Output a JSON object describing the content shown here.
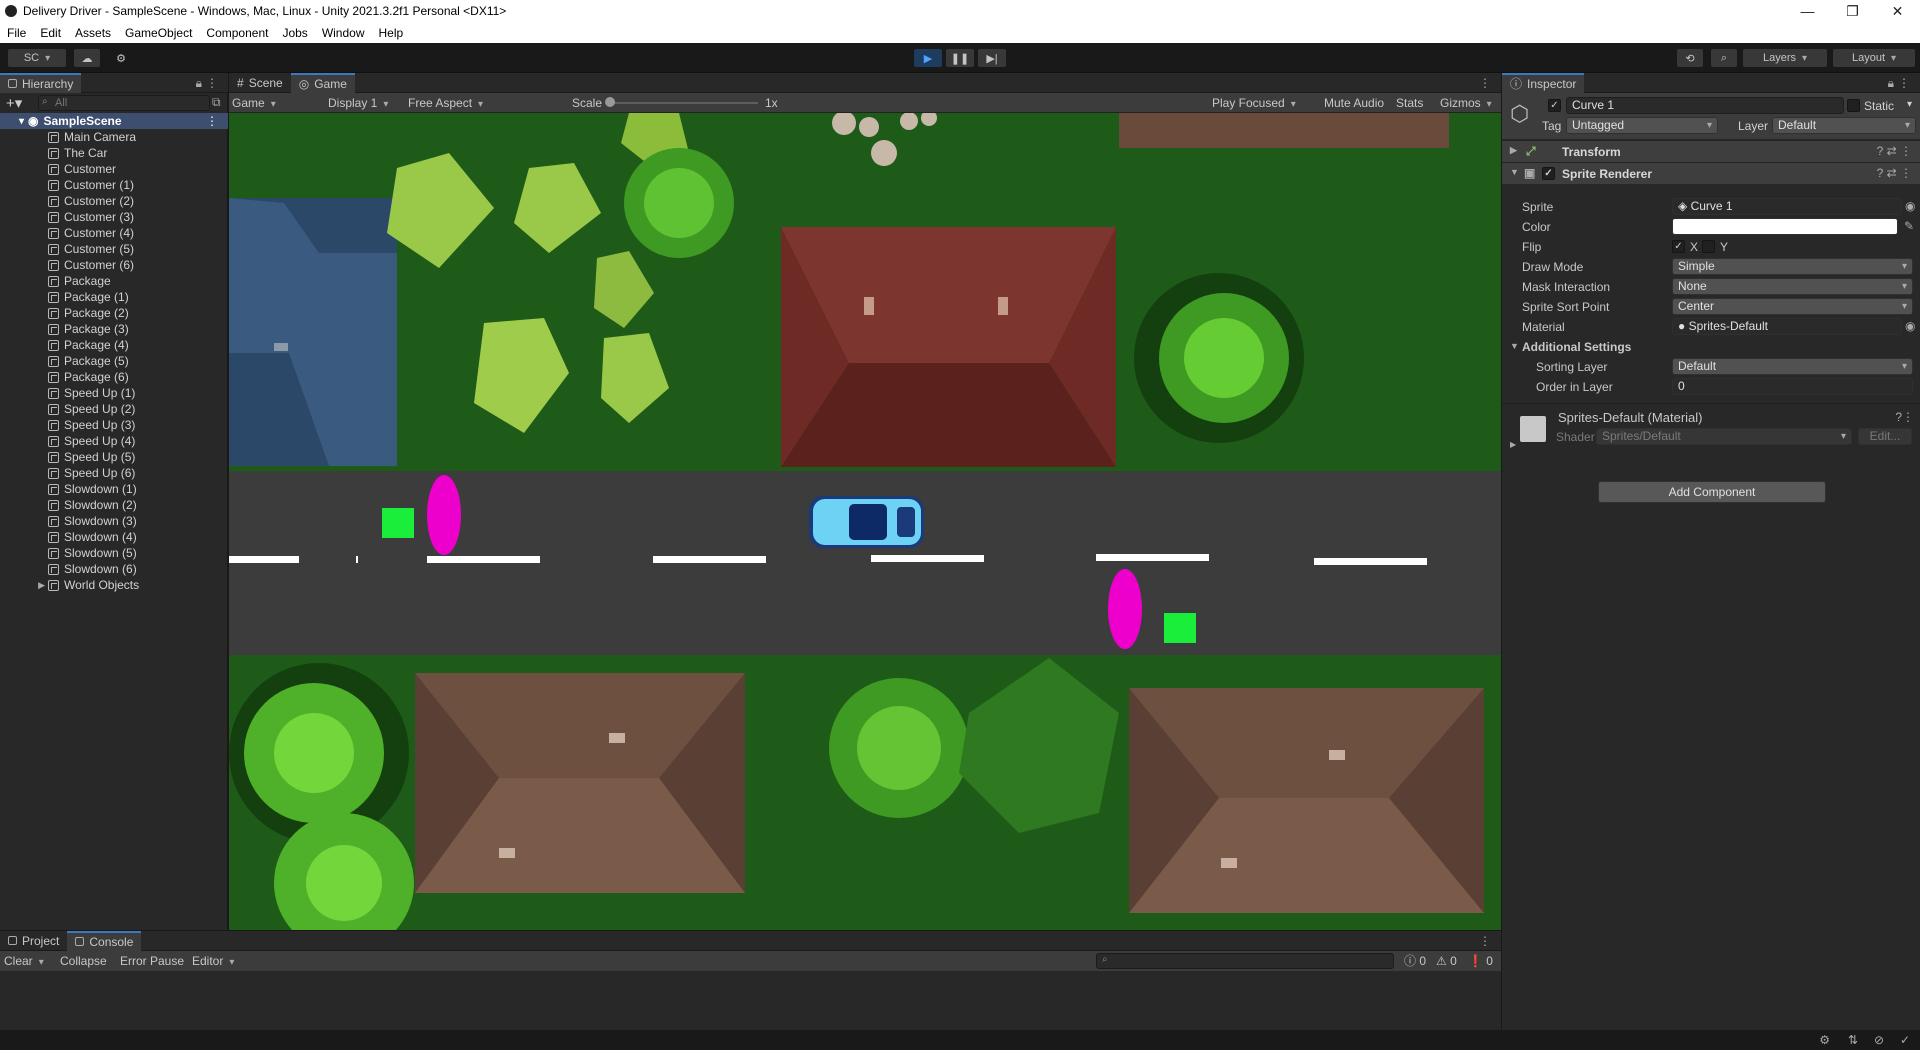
{
  "window": {
    "title": "Delivery Driver - SampleScene - Windows, Mac, Linux - Unity 2021.3.2f1 Personal <DX11>",
    "minimize": "—",
    "maximize": "❐",
    "close": "✕"
  },
  "menu": [
    "File",
    "Edit",
    "Assets",
    "GameObject",
    "Component",
    "Jobs",
    "Window",
    "Help"
  ],
  "toolbar": {
    "account": "SC",
    "layers": "Layers",
    "layout": "Layout"
  },
  "hierarchy": {
    "tab": "Hierarchy",
    "search_placeholder": "All",
    "scene": "SampleScene",
    "items": [
      "Main Camera",
      "The Car",
      "Customer",
      "Customer (1)",
      "Customer (2)",
      "Customer (3)",
      "Customer (4)",
      "Customer (5)",
      "Customer (6)",
      "Package",
      "Package (1)",
      "Package (2)",
      "Package (3)",
      "Package (4)",
      "Package (5)",
      "Package (6)",
      "Speed Up (1)",
      "Speed Up (2)",
      "Speed Up (3)",
      "Speed Up (4)",
      "Speed Up (5)",
      "Speed Up (6)",
      "Slowdown (1)",
      "Slowdown (2)",
      "Slowdown (3)",
      "Slowdown (4)",
      "Slowdown (5)",
      "Slowdown (6)",
      "World Objects"
    ]
  },
  "view": {
    "tabs": [
      "Scene",
      "Game"
    ],
    "game_mode": "Game",
    "display": "Display 1",
    "aspect": "Free Aspect",
    "scale_label": "Scale",
    "scale_value": "1x",
    "scale_level": 0,
    "play_focused": "Play Focused",
    "mute_audio": "Mute Audio",
    "stats": "Stats",
    "gizmos": "Gizmos"
  },
  "bottom": {
    "tabs": [
      "Project",
      "Console"
    ],
    "clear": "Clear",
    "collapse": "Collapse",
    "error_pause": "Error Pause",
    "editor": "Editor",
    "info_count": "0",
    "warn_count": "0",
    "error_count": "0"
  },
  "inspector": {
    "tab": "Inspector",
    "object_name": "Curve 1",
    "static": "Static",
    "tag_label": "Tag",
    "tag_value": "Untagged",
    "layer_label": "Layer",
    "layer_value": "Default",
    "transform": "Transform",
    "sprite_renderer": "Sprite Renderer",
    "fields": {
      "sprite": {
        "label": "Sprite",
        "value": "Curve 1"
      },
      "color": {
        "label": "Color"
      },
      "flip": {
        "label": "Flip",
        "x": "X",
        "y": "Y"
      },
      "draw_mode": {
        "label": "Draw Mode",
        "value": "Simple"
      },
      "mask_interaction": {
        "label": "Mask Interaction",
        "value": "None"
      },
      "sprite_sort_point": {
        "label": "Sprite Sort Point",
        "value": "Center"
      },
      "material": {
        "label": "Material",
        "value": "Sprites-Default"
      }
    },
    "additional_settings": "Additional Settings",
    "sorting_layer": {
      "label": "Sorting Layer",
      "value": "Default"
    },
    "order_in_layer": {
      "label": "Order in Layer",
      "value": "0"
    },
    "material_name": "Sprites-Default (Material)",
    "shader_label": "Shader",
    "shader_value": "Sprites/Default",
    "edit": "Edit...",
    "add_component": "Add Component"
  }
}
